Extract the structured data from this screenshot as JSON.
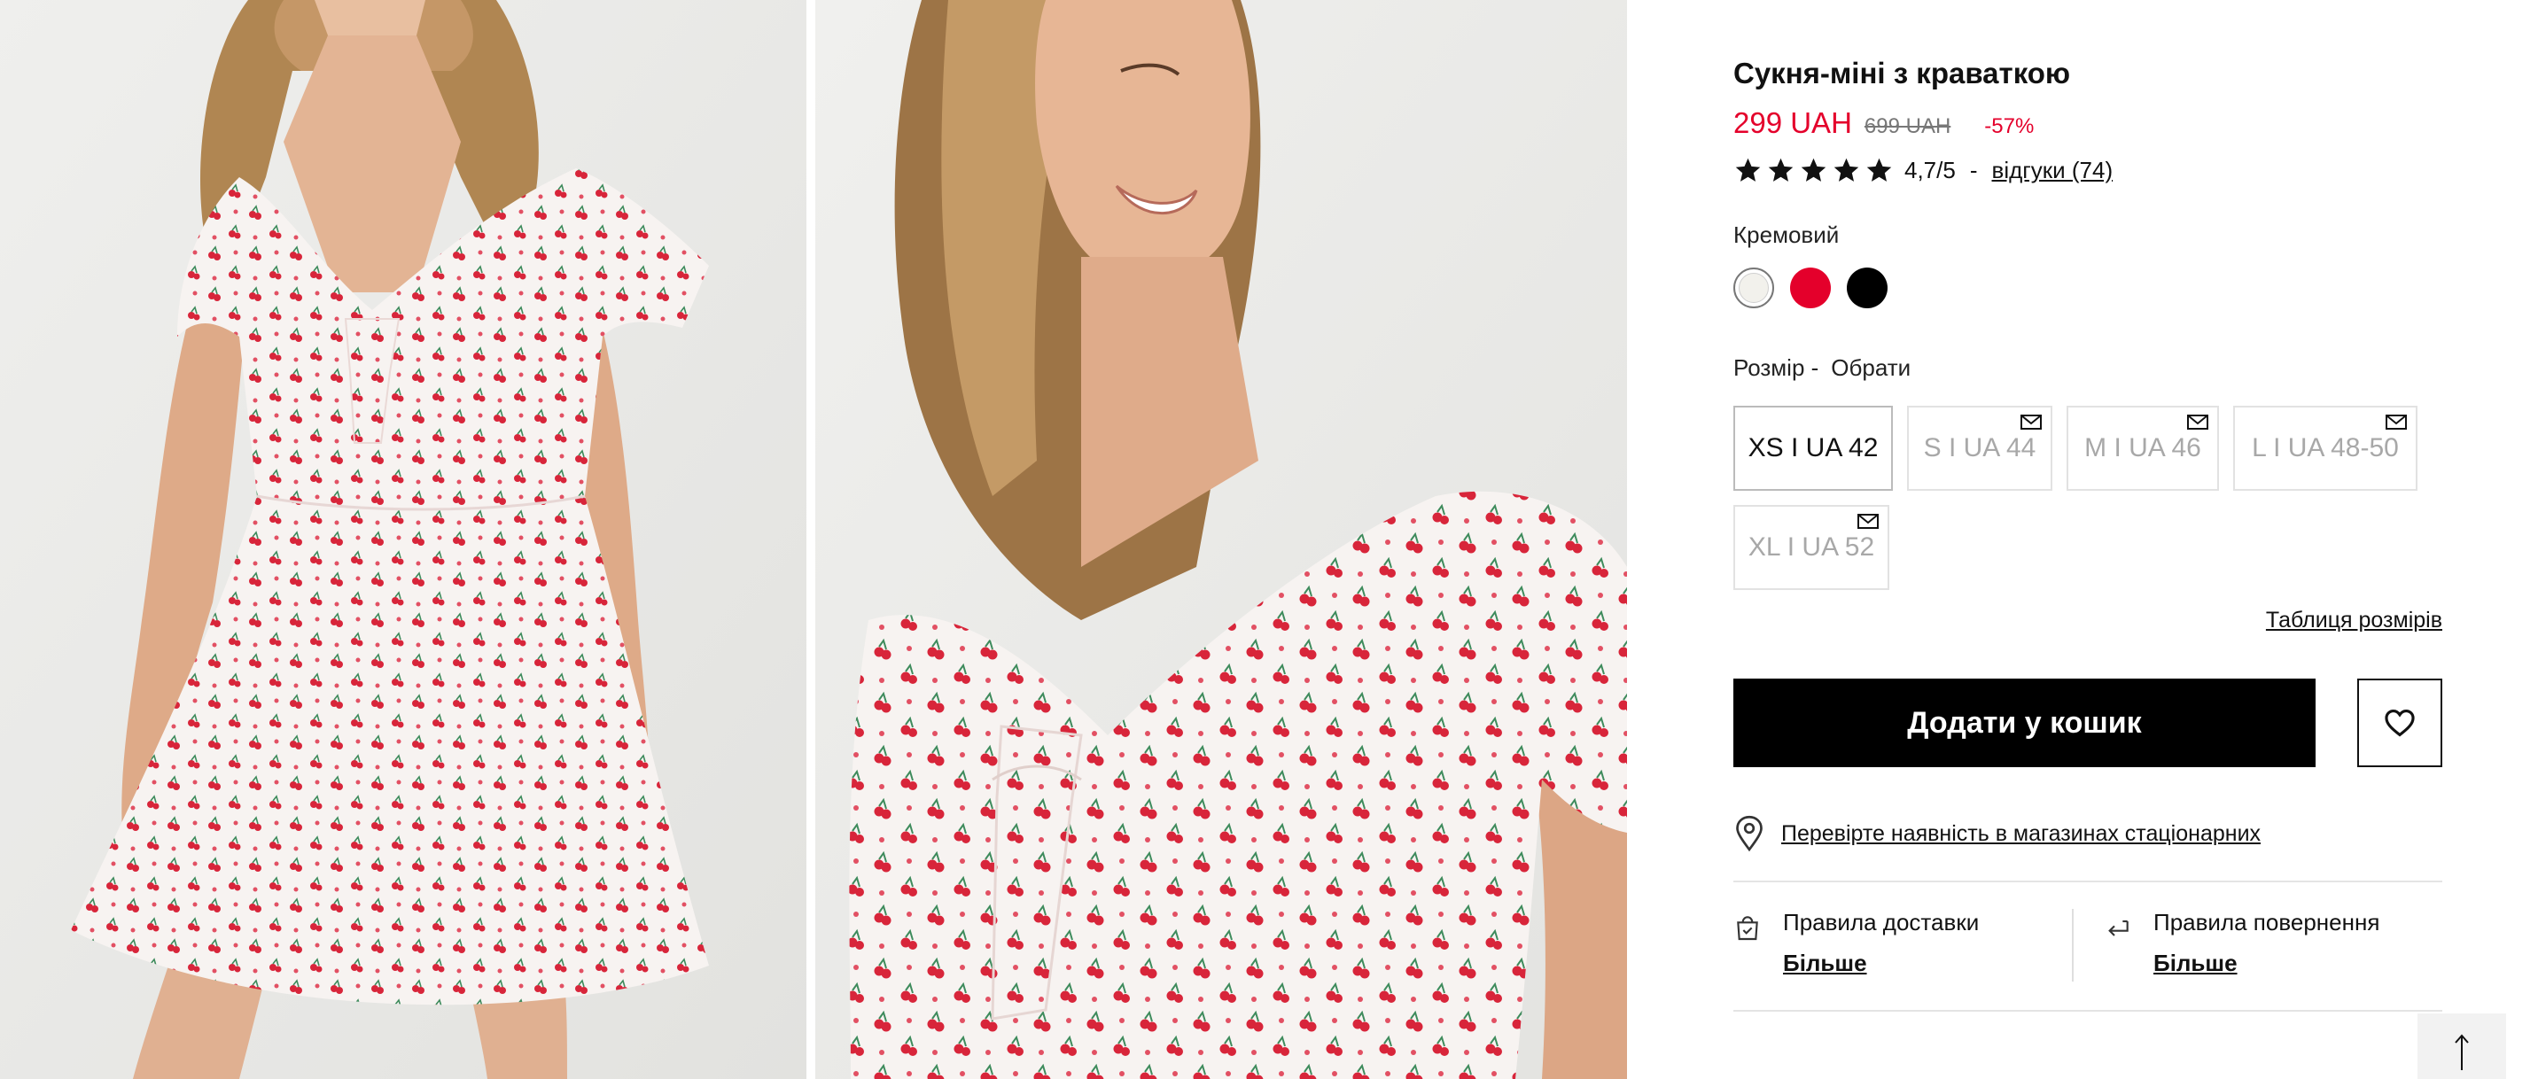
{
  "product": {
    "title": "Сукня-міні з краваткою",
    "price": "299 UAH",
    "old_price": "699 UAH",
    "discount": "-57%",
    "rating": {
      "stars": 5,
      "value": "4,7/5",
      "separator": "-",
      "reviews_label": "відгуки (74)"
    },
    "color": {
      "selected_name": "Кремовий",
      "swatches": [
        {
          "name": "cream",
          "hex": "#f2f1ec",
          "selected": true
        },
        {
          "name": "red",
          "hex": "#e4002b",
          "selected": false
        },
        {
          "name": "black",
          "hex": "#000000",
          "selected": false
        }
      ]
    },
    "size": {
      "label": "Розмір -",
      "prompt": "Обрати",
      "options": [
        {
          "label": "XS I UA 42",
          "available": true
        },
        {
          "label": "S I UA 44",
          "available": false
        },
        {
          "label": "M I UA 46",
          "available": false
        },
        {
          "label": "L I UA 48-50",
          "available": false
        },
        {
          "label": "XL I UA 52",
          "available": false
        }
      ],
      "table_link": "Таблиця розмірів"
    },
    "add_to_cart": "Додати у кошик",
    "store_check": "Перевірте наявність в магазинах стаціонарних",
    "delivery": {
      "title": "Правила доставки",
      "link": "Більше"
    },
    "returns": {
      "title": "Правила повернення",
      "link": "Більше"
    }
  },
  "colors": {
    "accent": "#e4002b",
    "button_bg": "#000000",
    "divider": "#e4e4e4"
  },
  "icons": {
    "wishlist": "heart-icon",
    "store": "location-pin-icon",
    "delivery": "delivery-bag-icon",
    "returns": "return-arrow-icon",
    "notify": "mail-icon",
    "scroll_top": "arrow-up-icon"
  }
}
